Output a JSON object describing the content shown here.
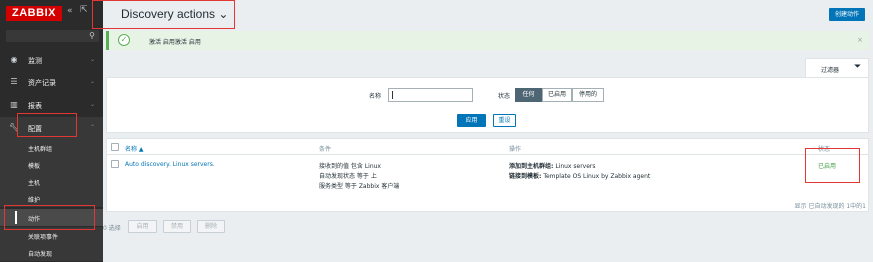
{
  "sidebar": {
    "logo": "ZABBIX",
    "collapse_icon": "«",
    "kiosk_icon": "⇱",
    "search_icon": "search-icon",
    "items": [
      {
        "label": "监测",
        "icon": "eye-icon"
      },
      {
        "label": "资产记录",
        "icon": "list-icon"
      },
      {
        "label": "报表",
        "icon": "chart-icon"
      },
      {
        "label": "配置",
        "icon": "wrench-icon"
      }
    ],
    "subitems": [
      "主机群组",
      "模板",
      "主机",
      "维护",
      "动作",
      "关联项事件",
      "自动发现"
    ]
  },
  "header": {
    "title": "Discovery actions",
    "title_chevron": "⌄",
    "create_button": "创建动作"
  },
  "message": {
    "text": "激活 启用激活 启用",
    "icon": "check-circle-icon",
    "close": "×"
  },
  "filter": {
    "tab_label": "过滤器",
    "tab_icon": "funnel-icon",
    "name_label": "名称",
    "name_value": "",
    "status_label": "状态",
    "status_options": [
      "任何",
      "已启用",
      "停用的"
    ],
    "apply_button": "应用",
    "reset_button": "重设"
  },
  "table": {
    "columns": [
      "名称 ▲",
      "条件",
      "操作",
      "状态"
    ],
    "rows": [
      {
        "name": "Auto discovery. Linux servers.",
        "conditions": [
          "接收到的值 包含 Linux",
          "自动发现状态 等于 上",
          "服务类型 等于 Zabbix 客户端"
        ],
        "operations": [
          {
            "label": "添加到主机群组:",
            "value": " Linux servers"
          },
          {
            "label": "链接到模板:",
            "value": " Template OS Linux by Zabbix agent"
          }
        ],
        "status": "已启用"
      }
    ],
    "footer": "显示 已自动发现的 1中的1"
  },
  "mass_actions": {
    "selected_label": "0 选择",
    "buttons": [
      "启用",
      "禁用",
      "删除"
    ]
  },
  "colors": {
    "logo_red": "#d40000",
    "accent_blue": "#0275b8",
    "enabled_green": "#429e47",
    "annotation_red": "#e33734"
  }
}
